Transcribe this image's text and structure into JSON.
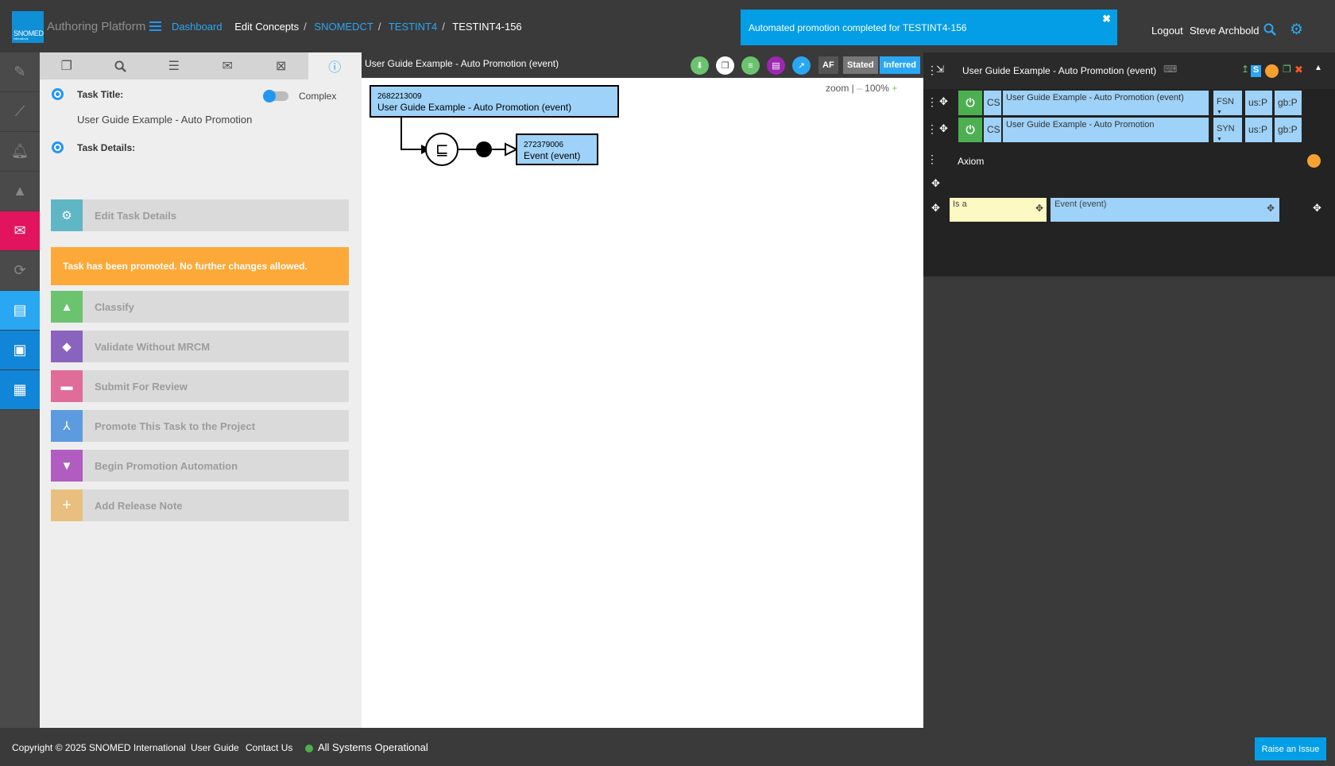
{
  "header": {
    "logo_text": "SNOMED",
    "logo_sub": "International",
    "app_title": "Authoring Platform",
    "breadcrumb": {
      "dashboard": "Dashboard",
      "edit": "Edit Concepts",
      "codesystem": "SNOMEDCT",
      "project": "TESTINT4",
      "task": "TESTINT4-156"
    },
    "toast": "Automated promotion completed for TESTINT4-156",
    "logout": "Logout",
    "user": "Steve Archbold"
  },
  "left_panel": {
    "task_title_label": "Task Title:",
    "complex_label": "Complex",
    "task_title_value": "User Guide Example - Auto Promotion",
    "task_details_label": "Task Details:",
    "edit_task": "Edit Task Details",
    "warning": "Task has been promoted. No further changes allowed.",
    "classify": "Classify",
    "validate": "Validate Without MRCM",
    "submit": "Submit For Review",
    "promote": "Promote This Task to the Project",
    "automation": "Begin Promotion Automation",
    "release_note": "Add Release Note"
  },
  "center": {
    "title": "User Guide Example - Auto Promotion (event)",
    "af": "AF",
    "stated": "Stated",
    "inferred": "Inferred",
    "zoom_label": "zoom |",
    "zoom_minus": "–",
    "zoom_value": "100%",
    "zoom_plus": "+",
    "concept_id": "2682213009",
    "concept_name": "User Guide Example - Auto Promotion (event)",
    "operator": "⊑",
    "parent_id": "272379006",
    "parent_name": "Event (event)"
  },
  "right_panel": {
    "title": "User Guide Example - Auto Promotion (event)",
    "s_badge": "S",
    "descriptions": [
      {
        "cs": "CS",
        "term": "User Guide Example - Auto Promotion (event)",
        "type": "FSN",
        "us": "us:P",
        "gb": "gb:P"
      },
      {
        "cs": "CS",
        "term": "User Guide Example - Auto Promotion",
        "type": "SYN",
        "us": "us:P",
        "gb": "gb:P"
      }
    ],
    "axiom_label": "Axiom",
    "rel_type": "Is a",
    "rel_target": "Event (event)"
  },
  "footer": {
    "copyright": "Copyright © 2025 SNOMED International",
    "user_guide": "User Guide",
    "contact": "Contact Us",
    "status": "All Systems Operational",
    "raise": "Raise an Issue"
  },
  "colors": {
    "accent": "#2aa7f2",
    "toast": "#049ee6",
    "warning": "#fca939",
    "concept_box": "#9fd2f8",
    "nav_active_red": "#e2145d"
  }
}
